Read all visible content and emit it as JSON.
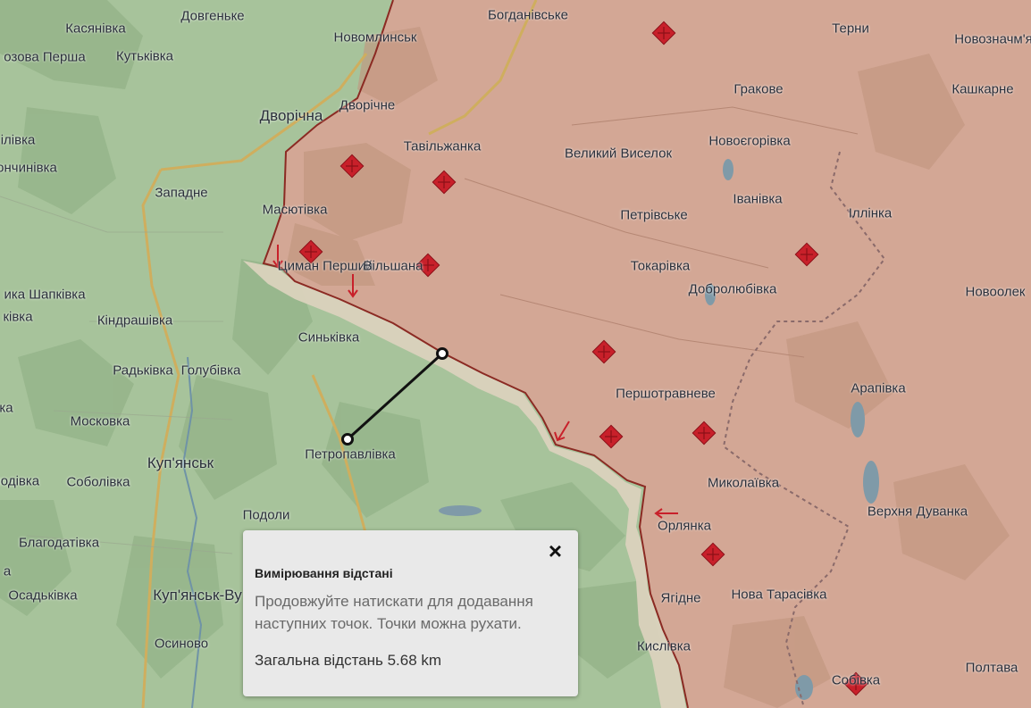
{
  "colors": {
    "friendly_area": "#a7c39b",
    "occupied_area": "#d3a795",
    "grey_zone": "#dad2bd",
    "front_line": "#8b2a23",
    "marker_red": "#c8202a",
    "road": "#cfae5e",
    "water": "#7f9aa8",
    "measure_line": "#111111"
  },
  "places": [
    {
      "name": "Касянівка"
    },
    {
      "name": "Довгеньке"
    },
    {
      "name": "Новомлинськ"
    },
    {
      "name": "Богданівське"
    },
    {
      "name": "Терни"
    },
    {
      "name": "Новозначм'я"
    },
    {
      "name": "озова Перша"
    },
    {
      "name": "Кутьківка"
    },
    {
      "name": "Гракове"
    },
    {
      "name": "Кашкарне"
    },
    {
      "name": "Дворічна"
    },
    {
      "name": "Дворічне"
    },
    {
      "name": "ілівка"
    },
    {
      "name": "Тавільжанка"
    },
    {
      "name": "Великий Виселок"
    },
    {
      "name": "Новоєгорівка"
    },
    {
      "name": "ончинівка"
    },
    {
      "name": "Западне"
    },
    {
      "name": "Іванівка"
    },
    {
      "name": "Масютівка"
    },
    {
      "name": "Петрівське"
    },
    {
      "name": "Іллінка"
    },
    {
      "name": "Циман Перший"
    },
    {
      "name": "Вільшана"
    },
    {
      "name": "Токарівка"
    },
    {
      "name": "Добролюбівка"
    },
    {
      "name": "Новоолек"
    },
    {
      "name": "ика Шапківка"
    },
    {
      "name": "ківка"
    },
    {
      "name": "Кіндрашівка"
    },
    {
      "name": "Синьківка"
    },
    {
      "name": "Радьківка"
    },
    {
      "name": "Голубівка"
    },
    {
      "name": "Арапівка"
    },
    {
      "name": "Першотравневе"
    },
    {
      "name": "ка"
    },
    {
      "name": "Московка"
    },
    {
      "name": "Куп'янськ"
    },
    {
      "name": "Петропавлівка"
    },
    {
      "name": "лодівка"
    },
    {
      "name": "Соболівка"
    },
    {
      "name": "Миколаївка"
    },
    {
      "name": "Верхня Дуванка"
    },
    {
      "name": "Подоли"
    },
    {
      "name": "Орлянка"
    },
    {
      "name": "Благодатівка"
    },
    {
      "name": "а"
    },
    {
      "name": "Куп'янськ-Ву"
    },
    {
      "name": "Осадьківка"
    },
    {
      "name": "Ягідне"
    },
    {
      "name": "Нова Тарасівка"
    },
    {
      "name": "Осиново"
    },
    {
      "name": "Кислівка"
    },
    {
      "name": "Полтава"
    },
    {
      "name": "Собівка"
    }
  ],
  "popup": {
    "title": "Вимірювання відстані",
    "description": "Продовжуйте натискати для додавання наступних точок. Точки можна рухати.",
    "total": "Загальна відстань 5.68 km",
    "close_icon": "×"
  }
}
